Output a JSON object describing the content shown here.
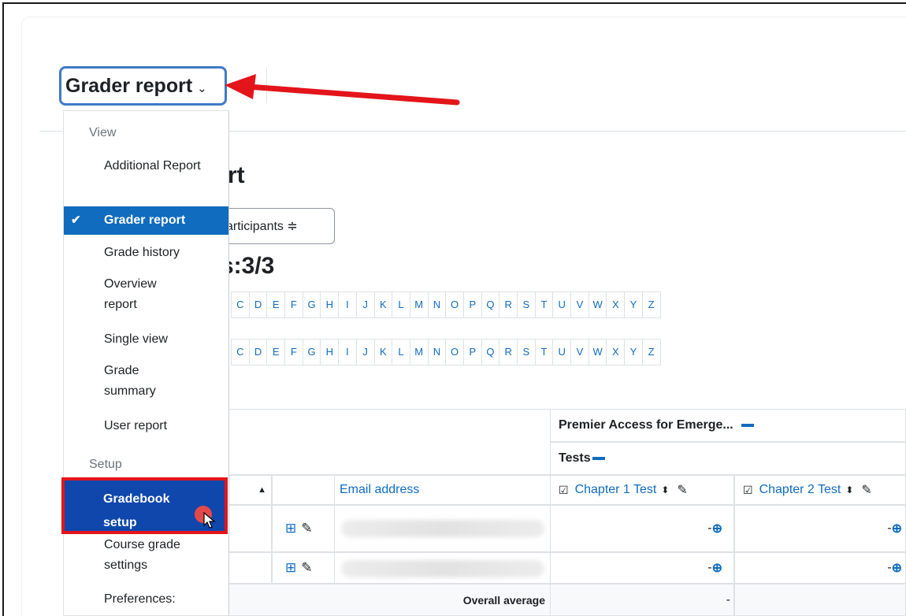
{
  "header": {
    "report_selector_label": "Grader report",
    "chevron": "⌄"
  },
  "page": {
    "title_fragment": "rt",
    "participants_label": "articipants ≑",
    "count_label": "ts:3/3"
  },
  "alphabet": [
    "C",
    "D",
    "E",
    "F",
    "G",
    "H",
    "I",
    "J",
    "K",
    "L",
    "M",
    "N",
    "O",
    "P",
    "Q",
    "R",
    "S",
    "T",
    "U",
    "V",
    "W",
    "X",
    "Y",
    "Z"
  ],
  "table": {
    "category_header": "Premier Access for Emerge...",
    "subcategory_header": "Tests",
    "email_header": "Email address",
    "col1": "Chapter 1 Test",
    "col2": "Chapter 2 Test",
    "grade_cell": "-",
    "overall_label": "Overall average",
    "overall_value": "-"
  },
  "menu": {
    "view_header": "View",
    "items": [
      "Additional Report",
      "Grader report",
      "Grade history",
      "Overview report",
      "Single view",
      "Grade summary",
      "User report"
    ],
    "setup_header": "Setup",
    "setup_items": [
      "Gradebook setup",
      "Course grade settings",
      "Preferences:"
    ]
  },
  "colors": {
    "accent": "#0f6cbf",
    "highlight": "#e3141a",
    "active_bg": "#0f47ad"
  }
}
